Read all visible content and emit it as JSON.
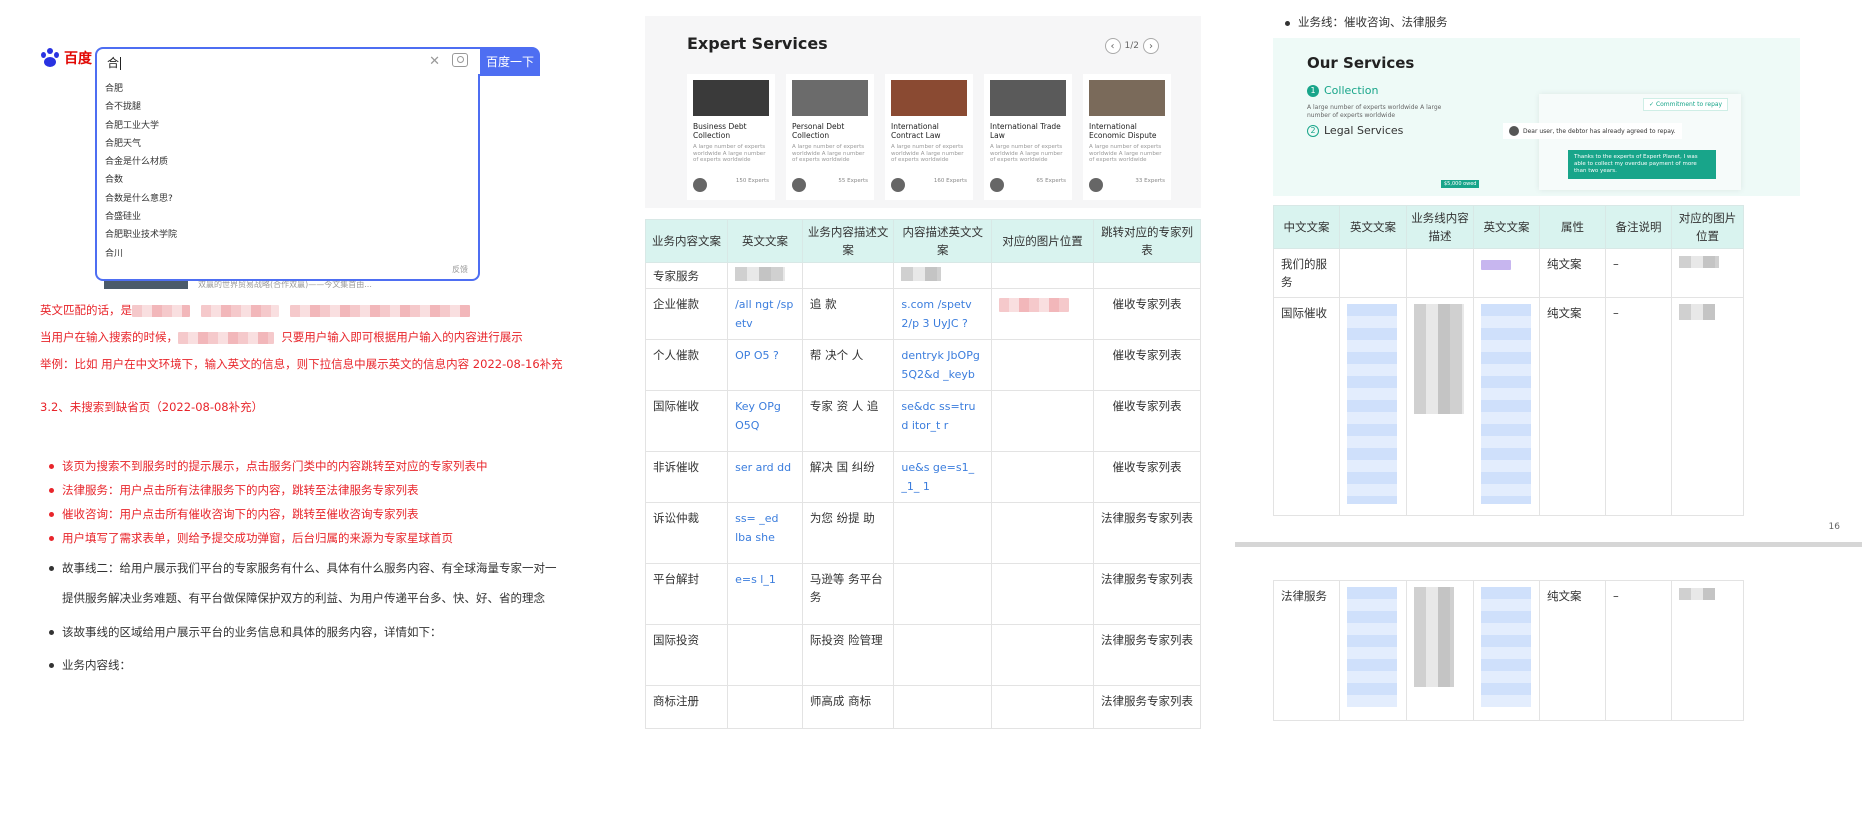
{
  "baidu": {
    "logo_text": "百度",
    "query": "合",
    "button_label": "百度一下",
    "suggestions": [
      "合肥",
      "合不拢腿",
      "合肥工业大学",
      "合肥天气",
      "合金是什么材质",
      "合数",
      "合数是什么意思?",
      "合盛硅业",
      "合肥职业技术学院",
      "合川"
    ],
    "feedback": "反馈",
    "behind_text": "双赢的世界贸易战略(合作双赢)——今文集首由..."
  },
  "left_notes": {
    "line1_prefix": "英文匹配的话，是",
    "line2_prefix": "当用户在输入搜索的时候，",
    "line2_suffix": "只要用户输入即可根据用户输入的内容进行展示",
    "line3": "举例：比如 用户在中文环境下，输入英文的信息，则下拉信息中展示英文的信息内容  2022-08-16补充",
    "section_heading": "3.2、未搜索到缺省页（2022-08-08补充）",
    "red_bullets": [
      "该页为搜索不到服务时的提示展示，点击服务门类中的内容跳转至对应的专家列表中",
      "法律服务：用户点击所有法律服务下的内容，跳转至法律服务专家列表",
      "催收咨询：用户点击所有催收咨询下的内容，跳转至催收咨询专家列表",
      "用户填写了需求表单，则给予提交成功弹窗，后台归属的来源为专家星球首页"
    ],
    "story_line_1": "故事线二：给用户展示我们平台的专家服务有什么、具体有什么服务内容、有全球海量专家一对一",
    "story_line_2": "提供服务解决业务难题、有平台做保障保护双方的利益、为用户传递平台多、快、好、省的理念",
    "story_area": "该故事线的区域给用户展示平台的业务信息和具体的服务内容，详情如下：",
    "business_line": "业务内容线："
  },
  "expert": {
    "title": "Expert Services",
    "pager": "1/2",
    "cards": [
      {
        "title": "Business Debt Collection",
        "desc": "A large number of experts worldwide A large number of experts worldwide",
        "count": "150 Experts",
        "img_color": "#3a3a3a"
      },
      {
        "title": "Personal Debt Collection",
        "desc": "A large number of experts worldwide A large number of experts worldwide",
        "count": "55 Experts",
        "img_color": "#6b6b6b"
      },
      {
        "title": "International Contract Law",
        "desc": "A large number of experts worldwide A large number of experts worldwide",
        "count": "160 Experts",
        "img_color": "#8a4a32"
      },
      {
        "title": "International Trade Law",
        "desc": "A large number of experts worldwide A large number of experts worldwide",
        "count": "65 Experts",
        "img_color": "#5a5a5a"
      },
      {
        "title": "International Economic Dispute",
        "desc": "A large number of experts worldwide A large number of experts worldwide",
        "count": "33 Experts",
        "img_color": "#7a6a5a"
      }
    ]
  },
  "mid_table": {
    "headers": [
      "业务内容文案",
      "英文文案",
      "业务内容描述文案",
      "内容描述英文文案",
      "对应的图片位置",
      "跳转对应的专家列表"
    ],
    "rows": [
      {
        "name": "专家服务",
        "english": "",
        "desc": "",
        "desc_en": "",
        "jump": ""
      },
      {
        "name": "企业催款",
        "english": "/all ngt /sp etv",
        "desc": "追 款",
        "desc_en": "s.com /spetv 2/p 3 UyJC ?",
        "jump": "催收专家列表"
      },
      {
        "name": "个人催款",
        "english": "OP O5 ?",
        "desc": "帮 决个 人",
        "desc_en": "dentryk JbOPg 5Q2&d _keyb",
        "jump": "催收专家列表"
      },
      {
        "name": "国际催收",
        "english": "Key OPg O5Q",
        "desc": "专家 资 人 追",
        "desc_en": "se&dc ss=tru d itor_t r",
        "jump": "催收专家列表"
      },
      {
        "name": "非诉催收",
        "english": "ser ard dd",
        "desc": "解决 国 纠纷",
        "desc_en": "ue&s ge=s1_ _1_ 1",
        "jump": "催收专家列表"
      },
      {
        "name": "诉讼仲裁",
        "english": "ss= _ed lba she",
        "desc": "为您 纷提 助",
        "desc_en": "",
        "jump": "法律服务专家列表"
      },
      {
        "name": "平台解封",
        "english": "e=s l_1",
        "desc": "马逊等 务平台 务",
        "desc_en": "",
        "jump": "法律服务专家列表"
      },
      {
        "name": "国际投资",
        "english": "",
        "desc": "际投资 险管理",
        "desc_en": "",
        "jump": "法律服务专家列表"
      },
      {
        "name": "商标注册",
        "english": "",
        "desc": "师高成 商标",
        "desc_en": "",
        "jump": "法律服务专家列表"
      }
    ]
  },
  "right": {
    "top_bullet": "业务线：催收咨询、法律服务",
    "services_title": "Our Services",
    "svc1": {
      "num": "1",
      "label": "Collection",
      "desc": "A large number of experts worldwide A large number of experts worldwide"
    },
    "svc2": {
      "num": "2",
      "label": "Legal Services"
    },
    "commitment": "Commitment to repay",
    "dear_msg": "Dear user, the debtor has already agreed to repay.",
    "thanks_msg": "Thanks to the experts of Expert Planet, I was able to collect my overdue payment of more than two years.",
    "green_tag": "$5,000 owed",
    "table_headers": [
      "中文文案",
      "英文文案",
      "业务线内容描述",
      "英文文案",
      "属性",
      "备注说明",
      "对应的图片位置"
    ],
    "rows": [
      {
        "cn": "我们的服务",
        "en": "",
        "desc": "",
        "en2": "",
        "attr": "纯文案",
        "note": "–",
        "img": ""
      },
      {
        "cn": "国际催收",
        "en": "H d a r 2 g Q d =p g3",
        "desc": "你 务 催 接 高效 收回",
        "en2": "li gt sp tv 5 g Q2 de =pl g3U",
        "attr": "纯文案",
        "note": "–",
        "img": ""
      }
    ],
    "page_number": "16",
    "row2": {
      "cn": "法律服务",
      "en": "2& _I = _ tr itor r=tru she",
      "desc": "汇 世 J 顶 帮 个 法 律纠纷。",
      "en2": "2& _ke =f _F tr d itor_ a r=true&she",
      "attr": "纯文案",
      "note": "–",
      "img": ""
    }
  }
}
